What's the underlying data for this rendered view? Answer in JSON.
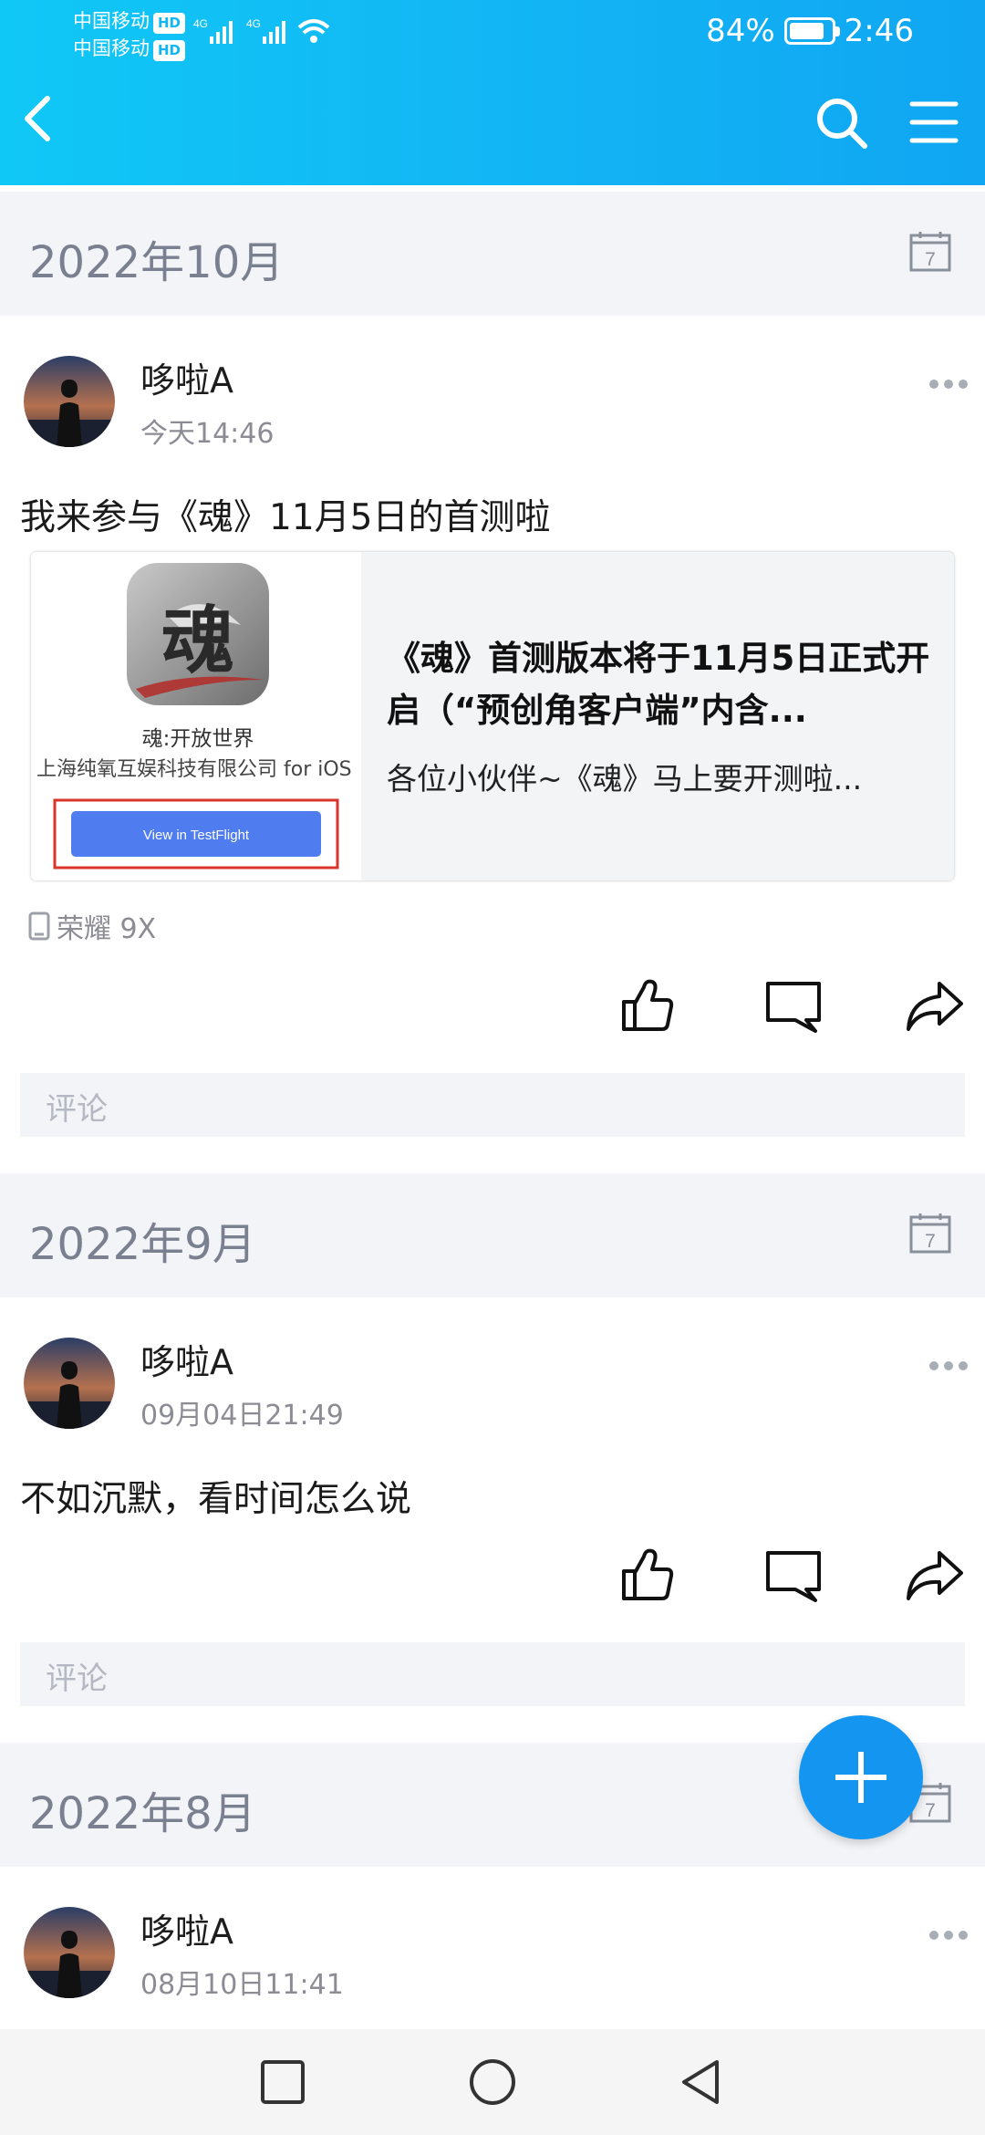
{
  "status_bar": {
    "carrier_1": "中国移动",
    "carrier_2": "中国移动",
    "hd": "HD",
    "network": "4G",
    "battery": "84%",
    "battery_level": 0.84,
    "time": "2:46"
  },
  "header": {
    "back_icon": "chevron-left-icon",
    "search_icon": "search-icon",
    "menu_icon": "menu-icon"
  },
  "sections": [
    {
      "month": "2022年10月",
      "post": {
        "author": "哆啦A",
        "time": "今天14:46",
        "text": "我来参与《魂》11月5日的首测啦",
        "card": {
          "app_char": "魂",
          "app_name": "魂:开放世界",
          "company": "上海纯氧互娱科技有限公司 for iOS",
          "testflight_button": "View in TestFlight",
          "title": "《魂》首测版本将于11月5日正式开启（“预创角客户端”内含...",
          "desc": "各位小伙伴~《魂》马上要开测啦..."
        },
        "device": "荣耀 9X",
        "comment_placeholder": "评论"
      }
    },
    {
      "month": "2022年9月",
      "post": {
        "author": "哆啦A",
        "time": "09月04日21:49",
        "text": "不如沉默，看时间怎么说",
        "comment_placeholder": "评论"
      }
    },
    {
      "month": "2022年8月",
      "post": {
        "author": "哆啦A",
        "time": "08月10日11:41"
      }
    }
  ],
  "calendar_day": "7",
  "fab_icon": "plus-icon",
  "colors": {
    "accent": "#12b6f4",
    "fab": "#1496f0",
    "band": "#f2f4f7"
  }
}
